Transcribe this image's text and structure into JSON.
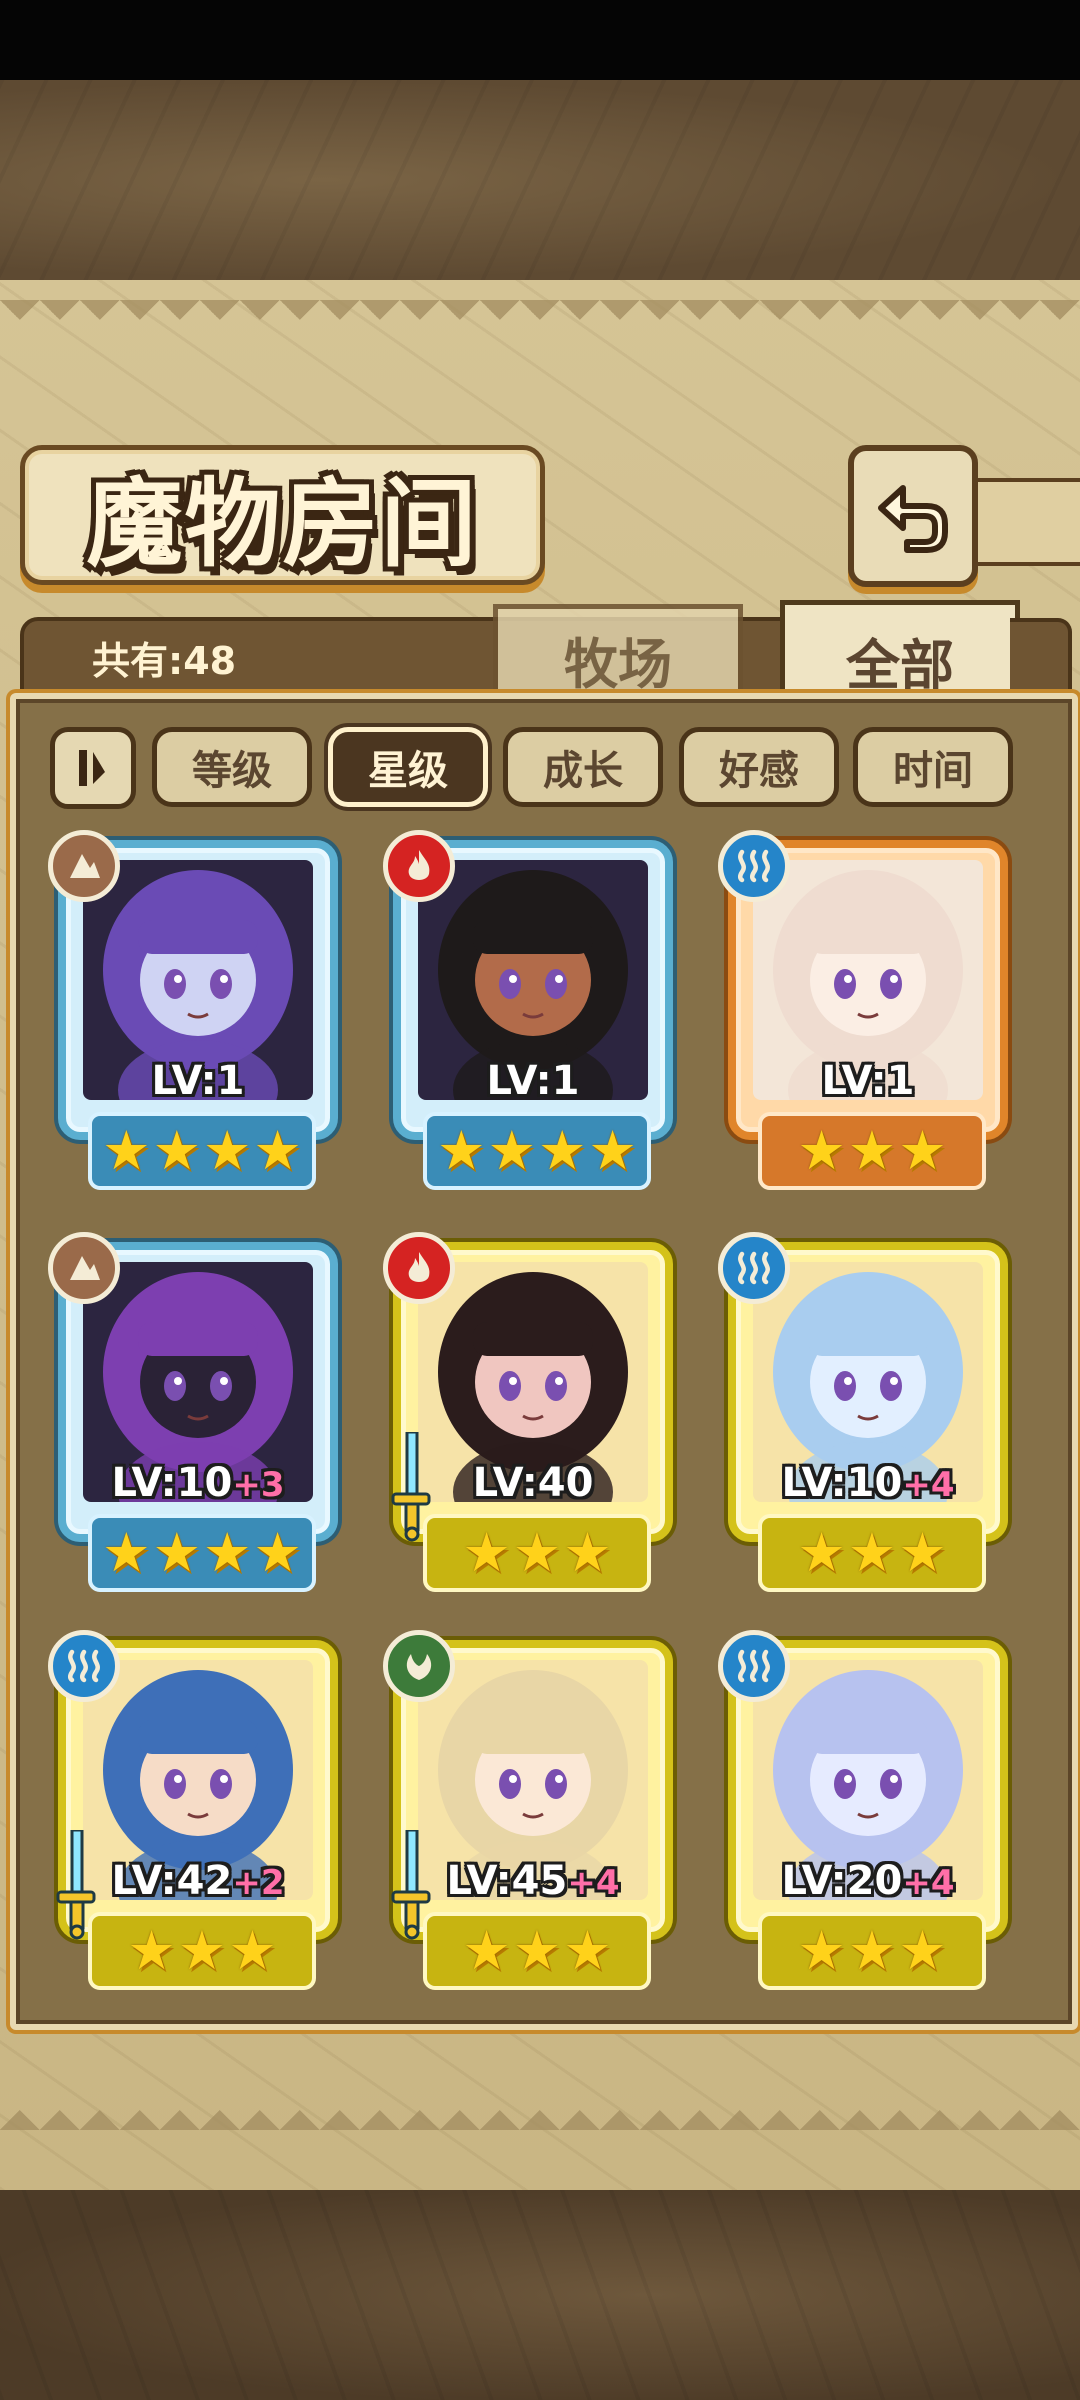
{
  "header": {
    "title": "魔物房间"
  },
  "count": {
    "text": "共有:48"
  },
  "tabs": [
    {
      "label": "牧场",
      "active": false
    },
    {
      "label": "全部",
      "active": true
    }
  ],
  "filters": [
    {
      "label": "等级",
      "active": false
    },
    {
      "label": "星级",
      "active": true
    },
    {
      "label": "成长",
      "active": false
    },
    {
      "label": "好感",
      "active": false
    },
    {
      "label": "时间",
      "active": false
    }
  ],
  "monsters": [
    {
      "rank": "A",
      "element": "earth",
      "level": "LV:1",
      "bonus": "",
      "stars": 4,
      "sword": false,
      "hair": "#6a4bb5",
      "skin": "#cfd3f3"
    },
    {
      "rank": "A",
      "element": "fire",
      "level": "LV:1",
      "bonus": "",
      "stars": 4,
      "sword": false,
      "hair": "#1e1a1a",
      "skin": "#b26b4a"
    },
    {
      "rank": "B",
      "element": "water",
      "level": "LV:1",
      "bonus": "",
      "stars": 3,
      "sword": false,
      "hair": "#efdcd0",
      "skin": "#fbeee4"
    },
    {
      "rank": "A",
      "element": "earth",
      "level": "LV:10",
      "bonus": "+3",
      "stars": 4,
      "sword": false,
      "hair": "#7d3fb0",
      "skin": "#2a2236"
    },
    {
      "rank": "S",
      "element": "fire",
      "level": "LV:40",
      "bonus": "",
      "stars": 3,
      "sword": true,
      "hair": "#2b1c1c",
      "skin": "#f0c6c0"
    },
    {
      "rank": "S",
      "element": "water",
      "level": "LV:10",
      "bonus": "+4",
      "stars": 3,
      "sword": false,
      "hair": "#a9cdef",
      "skin": "#e2efff"
    },
    {
      "rank": "S",
      "element": "water",
      "level": "LV:42",
      "bonus": "+2",
      "stars": 3,
      "sword": true,
      "hair": "#3e6fb8",
      "skin": "#f6dcc7"
    },
    {
      "rank": "S",
      "element": "wood",
      "level": "LV:45",
      "bonus": "+4",
      "stars": 3,
      "sword": true,
      "hair": "#e8d6a6",
      "skin": "#fbe8d6"
    },
    {
      "rank": "S",
      "element": "water",
      "level": "LV:20",
      "bonus": "+4",
      "stars": 3,
      "sword": false,
      "hair": "#b7c2ef",
      "skin": "#e6ebff"
    }
  ]
}
